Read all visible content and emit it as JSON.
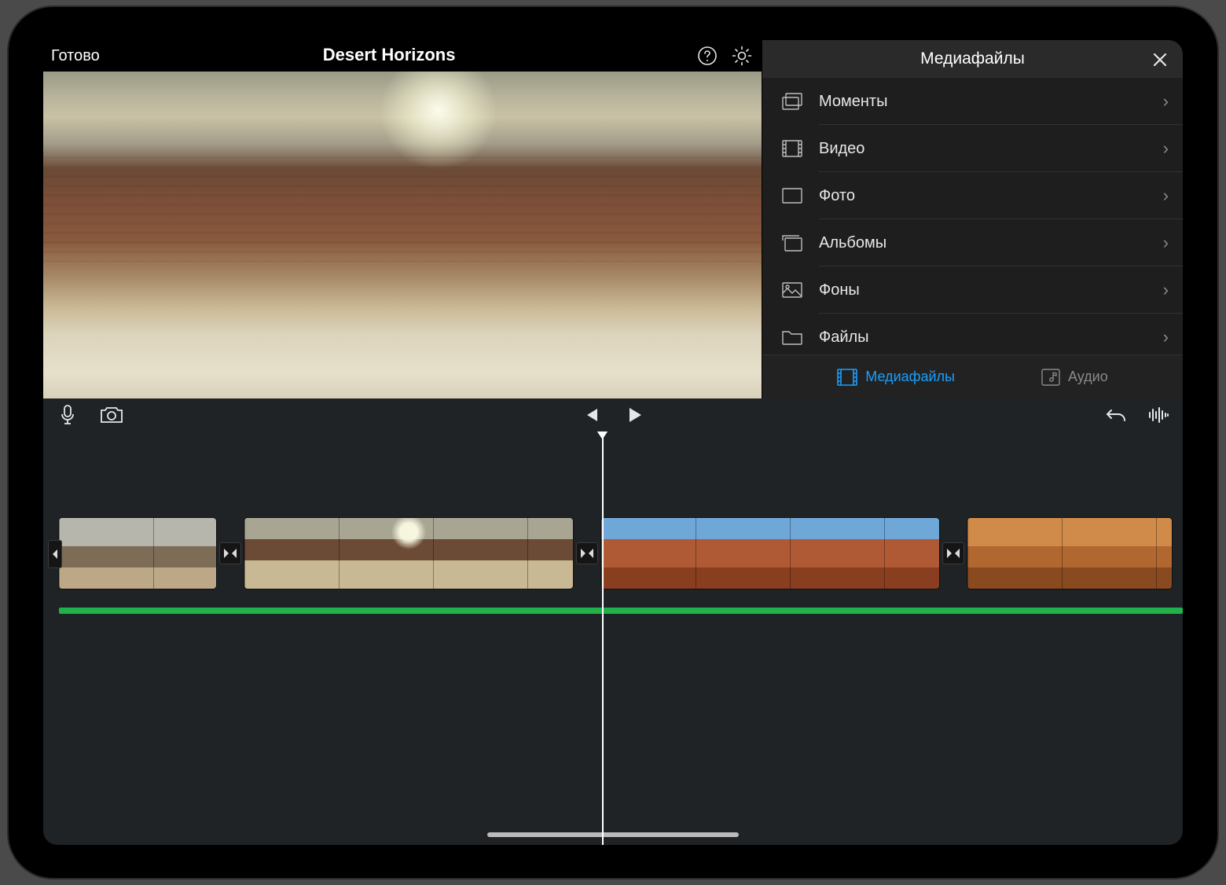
{
  "header": {
    "done_label": "Готово",
    "project_title": "Desert Horizons"
  },
  "media_panel": {
    "title": "Медиафайлы",
    "items": [
      {
        "label": "Моменты",
        "icon": "moments-icon"
      },
      {
        "label": "Видео",
        "icon": "video-icon"
      },
      {
        "label": "Фото",
        "icon": "photo-icon"
      },
      {
        "label": "Альбомы",
        "icon": "albums-icon"
      },
      {
        "label": "Фоны",
        "icon": "backgrounds-icon"
      },
      {
        "label": "Файлы",
        "icon": "files-icon"
      }
    ],
    "tabs": {
      "media_label": "Медиафайлы",
      "audio_label": "Аудио",
      "active": "media"
    }
  },
  "colors": {
    "accent": "#1aa0ff",
    "audio_track": "#20b24a",
    "panel_bg": "#1e1e1e",
    "timeline_bg": "#1f2326"
  }
}
